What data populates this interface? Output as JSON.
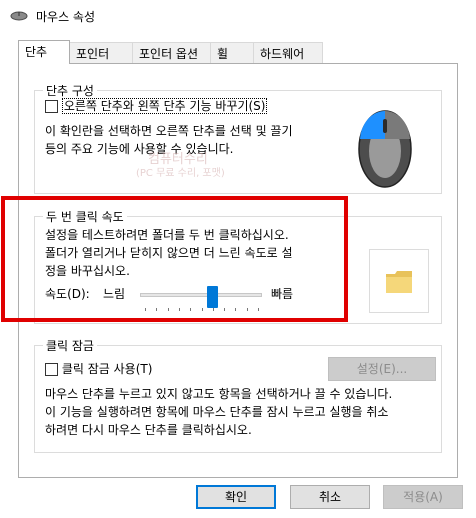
{
  "window": {
    "title": "마우스 속성"
  },
  "tabs": [
    {
      "label": "단추",
      "active": true
    },
    {
      "label": "포인터"
    },
    {
      "label": "포인터 옵션"
    },
    {
      "label": "휠"
    },
    {
      "label": "하드웨어"
    }
  ],
  "button_config": {
    "title": "단추 구성",
    "checkbox_label": "오른쪽 단추와 왼쪽 단추 기능 바꾸기(S)",
    "desc_line1": "이 확인란을 선택하면 오른쪽 단추를 선택 및 끌기",
    "desc_line2": "등의 주요 기능에 사용할 수 있습니다."
  },
  "double_click": {
    "title": "두 번 클릭 속도",
    "desc_line1": "설정을 테스트하려면 폴더를 두 번 클릭하십시오.",
    "desc_line2": "폴더가 열리거나 닫히지 않으면 더 느린 속도로 설",
    "desc_line3": "정을 바꾸십시오.",
    "speed_label": "속도(D):",
    "slow_label": "느림",
    "fast_label": "빠름",
    "slider_value_fraction": 0.6
  },
  "click_lock": {
    "title": "클릭 잠금",
    "checkbox_label": "클릭 잠금 사용(T)",
    "settings_button": "설정(E)...",
    "desc_line1": "마우스 단추를 누르고 있지 않고도 항목을 선택하거나 끌 수 있습니다.",
    "desc_line2": "이 기능을 실행하려면 항목에 마우스 단추를 잠시 누르고 실행을 취소",
    "desc_line3": "하려면 다시 마우스 단추를 클릭하십시오."
  },
  "footer": {
    "ok": "확인",
    "cancel": "취소",
    "apply": "적용(A)"
  },
  "watermark": {
    "line1": "컴퓨터수리",
    "line2": "(PC 무료 수리, 포맷)"
  },
  "colors": {
    "accent": "#0078d7",
    "highlight_box": "#e00000"
  }
}
